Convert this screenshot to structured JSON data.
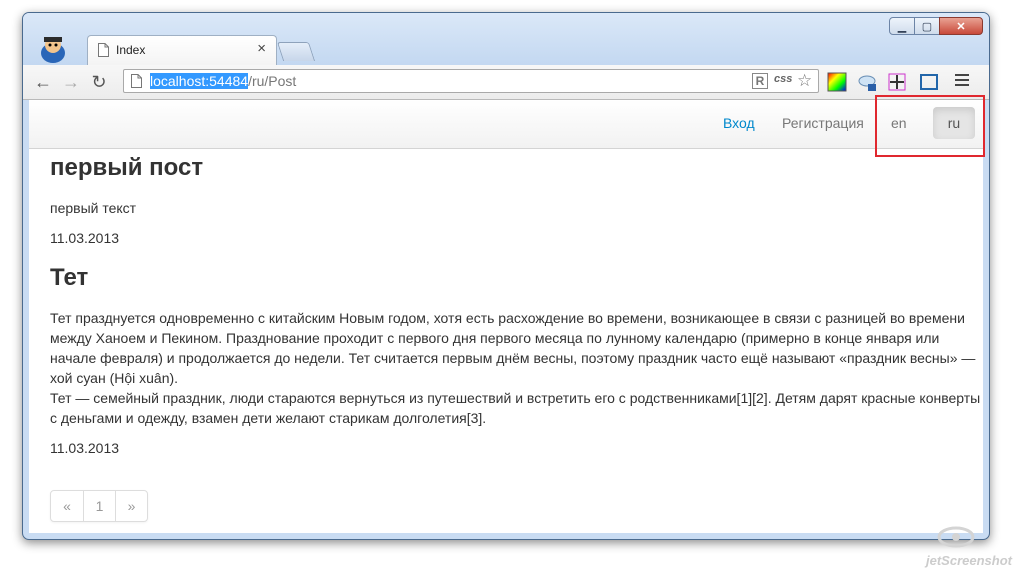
{
  "browser": {
    "tab_title": "Index",
    "tab_close": "×",
    "url_host": "localhost:54484",
    "url_path": "/ru/Post",
    "ext_r": "R",
    "ext_css": "css",
    "window_buttons": {
      "minimize": "▁",
      "maximize": "▢",
      "close": "✕"
    },
    "nav": {
      "back": "←",
      "forward": "→",
      "reload": "↻"
    },
    "star": "☆"
  },
  "navbar": {
    "login": "Вход",
    "register": "Регистрация",
    "lang_en": "en",
    "lang_ru": "ru"
  },
  "posts": [
    {
      "title": "первый пост",
      "text": "первый текст",
      "date": "11.03.2013"
    },
    {
      "title": "Тет",
      "paragraph1": "Тет празднуется одновременно с китайским Новым годом, хотя есть расхождение во времени, возникающее в связи с разницей во времени между Ханоем и Пекином. Празднование проходит с первого дня первого месяца по лунному календарю (примерно в конце января или начале февраля) и продолжается до недели. Тет считается первым днём весны, поэтому праздник часто ещё называют «праздник весны» — хой суан (Hội xuân).",
      "paragraph2": "Тет — семейный праздник, люди стараются вернуться из путешествий и встретить его с родственниками[1][2]. Детям дарят красные конверты с деньгами и одежду, взамен дети желают старикам долголетия[3].",
      "date": "11.03.2013"
    }
  ],
  "pager": {
    "prev": "«",
    "page": "1",
    "next": "»"
  },
  "watermark": "jetScreenshot",
  "colors": {
    "link": "#0088cc",
    "highlight": "#e0282f",
    "selection": "#3399ff"
  }
}
